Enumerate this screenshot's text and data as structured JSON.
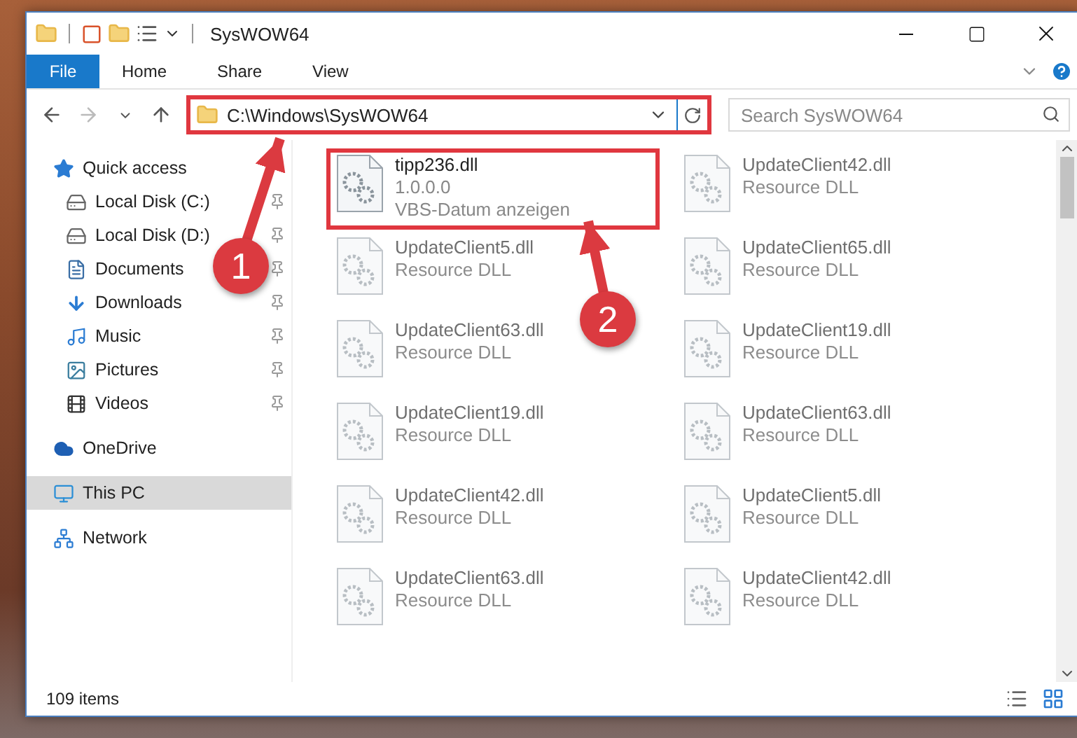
{
  "window": {
    "title": "SysWOW64"
  },
  "ribbon_tabs": [
    {
      "label": "File",
      "selected": true
    },
    {
      "label": "Home",
      "selected": false
    },
    {
      "label": "Share",
      "selected": false
    },
    {
      "label": "View",
      "selected": false
    }
  ],
  "address": {
    "path": "C:\\Windows\\SysWOW64",
    "highlighted": true
  },
  "search": {
    "placeholder": "Search SysWOW64"
  },
  "nav": [
    {
      "label": "Quick access",
      "kind": "star",
      "selected": false,
      "children": [
        {
          "label": "Local Disk (C:)",
          "kind": "system-drive",
          "pinned": true,
          "selected": false
        },
        {
          "label": "Local Disk (D:)",
          "kind": "drive",
          "pinned": true,
          "selected": false
        },
        {
          "label": "Documents",
          "kind": "documents",
          "pinned": true,
          "selected": false
        },
        {
          "label": "Downloads",
          "kind": "downloads",
          "pinned": true,
          "selected": false
        },
        {
          "label": "Music",
          "kind": "music",
          "pinned": true,
          "selected": false
        },
        {
          "label": "Pictures",
          "kind": "pictures",
          "pinned": true,
          "selected": false
        },
        {
          "label": "Videos",
          "kind": "videos",
          "pinned": true,
          "selected": false
        }
      ]
    },
    {
      "label": "OneDrive",
      "kind": "cloud",
      "selected": false
    },
    {
      "label": "This PC",
      "kind": "computer",
      "selected": true
    },
    {
      "label": "Network",
      "kind": "network",
      "selected": false
    }
  ],
  "files": [
    {
      "name": "tipp236.dll",
      "details": [
        "1.0.0.0",
        "VBS-Datum anzeigen"
      ],
      "blurred": false,
      "highlighted": true
    },
    {
      "name": "UpdateClient42.dll",
      "details": [
        "Resource DLL"
      ],
      "blurred": true,
      "highlighted": false
    },
    {
      "name": "UpdateClient5.dll",
      "details": [
        "Resource DLL"
      ],
      "blurred": true,
      "highlighted": false
    },
    {
      "name": "UpdateClient65.dll",
      "details": [
        "Resource DLL"
      ],
      "blurred": true,
      "highlighted": false
    },
    {
      "name": "UpdateClient63.dll",
      "details": [
        "Resource DLL"
      ],
      "blurred": true,
      "highlighted": false
    },
    {
      "name": "UpdateClient19.dll",
      "details": [
        "Resource DLL"
      ],
      "blurred": true,
      "highlighted": false
    },
    {
      "name": "UpdateClient19.dll",
      "details": [
        "Resource DLL"
      ],
      "blurred": true,
      "highlighted": false
    },
    {
      "name": "UpdateClient63.dll",
      "details": [
        "Resource DLL"
      ],
      "blurred": true,
      "highlighted": false
    },
    {
      "name": "UpdateClient42.dll",
      "details": [
        "Resource DLL"
      ],
      "blurred": true,
      "highlighted": false
    },
    {
      "name": "UpdateClient5.dll",
      "details": [
        "Resource DLL"
      ],
      "blurred": true,
      "highlighted": false
    },
    {
      "name": "UpdateClient63.dll",
      "details": [
        "Resource DLL"
      ],
      "blurred": true,
      "highlighted": false
    },
    {
      "name": "UpdateClient42.dll",
      "details": [
        "Resource DLL"
      ],
      "blurred": true,
      "highlighted": false
    }
  ],
  "status_bar": {
    "count": "109 items"
  },
  "callouts": [
    {
      "label": "1"
    },
    {
      "label": "2"
    }
  ]
}
